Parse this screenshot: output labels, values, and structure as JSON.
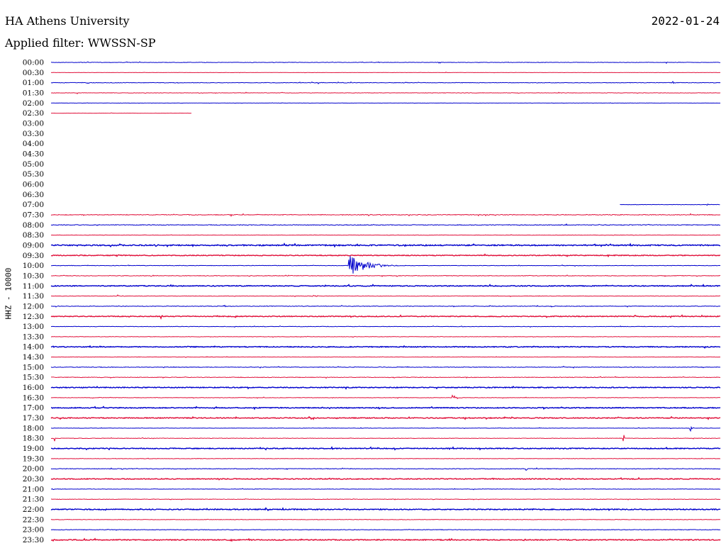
{
  "header": {
    "title": "HA Athens University",
    "filter": "Applied filter: WWSSN-SP",
    "date": "2022-01-24"
  },
  "channel_label": "HHZ - 10000",
  "colors": {
    "even_trace": "#0000cc",
    "odd_trace": "#e0103a",
    "background": "#ffffff"
  },
  "chart_data": {
    "type": "line",
    "title": "HA Athens University",
    "subtitle": "Applied filter: WWSSN-SP",
    "ylabel": "HHZ - 10000",
    "time_labels": [
      "00:00",
      "00:30",
      "01:00",
      "01:30",
      "02:00",
      "02:30",
      "03:00",
      "03:30",
      "04:00",
      "04:30",
      "05:00",
      "05:30",
      "06:00",
      "06:30",
      "07:00",
      "07:30",
      "08:00",
      "08:30",
      "09:00",
      "09:30",
      "10:00",
      "10:30",
      "11:00",
      "11:30",
      "12:00",
      "12:30",
      "13:00",
      "13:30",
      "14:00",
      "14:30",
      "15:00",
      "15:30",
      "16:00",
      "16:30",
      "17:00",
      "17:30",
      "18:00",
      "18:30",
      "19:00",
      "19:30",
      "20:00",
      "20:30",
      "21:00",
      "21:30",
      "22:00",
      "22:30",
      "23:00",
      "23:30"
    ],
    "minutes_per_line": 30,
    "traces": [
      {
        "t": "00:00",
        "start": 0,
        "end": 1,
        "noise": 0.6,
        "events": [
          [
            0.3,
            0.8,
            2
          ],
          [
            0.49,
            0.8,
            2
          ],
          [
            0.58,
            0.8,
            2
          ],
          [
            0.92,
            1.5,
            4
          ]
        ]
      },
      {
        "t": "00:30",
        "start": 0,
        "end": 1,
        "noise": 0.3,
        "events": [
          [
            0.59,
            0.8,
            2
          ]
        ]
      },
      {
        "t": "01:00",
        "start": 0,
        "end": 1,
        "noise": 0.7,
        "events": [
          [
            0.4,
            1.5,
            10
          ],
          [
            0.53,
            0.8,
            2
          ],
          [
            0.93,
            1.2,
            6
          ]
        ]
      },
      {
        "t": "01:30",
        "start": 0,
        "end": 1,
        "noise": 0.6,
        "events": [
          [
            0.04,
            1,
            8
          ],
          [
            0.14,
            0.8,
            2
          ]
        ]
      },
      {
        "t": "02:00",
        "start": 0,
        "end": 1,
        "noise": 0.3,
        "events": []
      },
      {
        "t": "02:30",
        "start": 0,
        "end": 0.21,
        "noise": 0.3,
        "events": [
          [
            0.09,
            0.8,
            2
          ]
        ]
      },
      {
        "t": "07:00",
        "start": 0.85,
        "end": 1,
        "noise": 0.5,
        "events": [
          [
            0.98,
            1,
            2
          ]
        ]
      },
      {
        "t": "07:30",
        "start": 0,
        "end": 1,
        "noise": 1.0,
        "events": [
          [
            0.27,
            1,
            3
          ],
          [
            0.38,
            1.6,
            3
          ]
        ]
      },
      {
        "t": "08:00",
        "start": 0,
        "end": 1,
        "noise": 1.0,
        "events": []
      },
      {
        "t": "08:30",
        "start": 0,
        "end": 1,
        "noise": 0.5,
        "events": []
      },
      {
        "t": "09:00",
        "start": 0,
        "end": 1,
        "noise": 1.6,
        "events": []
      },
      {
        "t": "09:30",
        "start": 0,
        "end": 1,
        "noise": 1.1,
        "events": []
      },
      {
        "t": "10:00",
        "start": 0,
        "end": 1,
        "noise": 0.6,
        "events": [
          [
            0.445,
            16,
            70
          ],
          [
            0.7,
            1,
            2
          ]
        ]
      },
      {
        "t": "10:30",
        "start": 0,
        "end": 1,
        "noise": 0.8,
        "events": [
          [
            0.15,
            1.5,
            22
          ],
          [
            0.28,
            0.8,
            2
          ]
        ]
      },
      {
        "t": "11:00",
        "start": 0,
        "end": 1,
        "noise": 1.2,
        "events": []
      },
      {
        "t": "11:30",
        "start": 0,
        "end": 1,
        "noise": 0.6,
        "events": [
          [
            0.1,
            1.8,
            14
          ],
          [
            0.39,
            2,
            20
          ]
        ]
      },
      {
        "t": "12:00",
        "start": 0,
        "end": 1,
        "noise": 0.8,
        "events": [
          [
            0.26,
            1.4,
            3
          ],
          [
            0.58,
            1.4,
            3
          ],
          [
            0.72,
            1,
            2
          ]
        ]
      },
      {
        "t": "12:30",
        "start": 0,
        "end": 1,
        "noise": 1.1,
        "events": [
          [
            0.165,
            4,
            3
          ]
        ]
      },
      {
        "t": "13:00",
        "start": 0,
        "end": 1,
        "noise": 0.6,
        "events": []
      },
      {
        "t": "13:30",
        "start": 0,
        "end": 1,
        "noise": 0.6,
        "events": []
      },
      {
        "t": "14:00",
        "start": 0,
        "end": 1,
        "noise": 1.2,
        "events": []
      },
      {
        "t": "14:30",
        "start": 0,
        "end": 1,
        "noise": 0.5,
        "events": []
      },
      {
        "t": "15:00",
        "start": 0,
        "end": 1,
        "noise": 0.8,
        "events": []
      },
      {
        "t": "15:30",
        "start": 0,
        "end": 1,
        "noise": 0.8,
        "events": []
      },
      {
        "t": "16:00",
        "start": 0,
        "end": 1,
        "noise": 1.2,
        "events": []
      },
      {
        "t": "16:30",
        "start": 0,
        "end": 1,
        "noise": 0.6,
        "events": [
          [
            0.6,
            3,
            24
          ]
        ]
      },
      {
        "t": "17:00",
        "start": 0,
        "end": 1,
        "noise": 1.2,
        "events": []
      },
      {
        "t": "17:30",
        "start": 0,
        "end": 1,
        "noise": 1.2,
        "events": []
      },
      {
        "t": "18:00",
        "start": 0,
        "end": 1,
        "noise": 0.5,
        "events": [
          [
            0.955,
            4.5,
            8
          ]
        ]
      },
      {
        "t": "18:30",
        "start": 0,
        "end": 1,
        "noise": 0.6,
        "events": [
          [
            0.005,
            7,
            1
          ],
          [
            0.855,
            8,
            1
          ]
        ]
      },
      {
        "t": "19:00",
        "start": 0,
        "end": 1,
        "noise": 1.2,
        "events": []
      },
      {
        "t": "19:30",
        "start": 0,
        "end": 1,
        "noise": 0.6,
        "events": []
      },
      {
        "t": "20:00",
        "start": 0,
        "end": 1,
        "noise": 0.8,
        "events": [
          [
            0.71,
            2,
            1
          ]
        ]
      },
      {
        "t": "20:30",
        "start": 0,
        "end": 1,
        "noise": 1.2,
        "events": []
      },
      {
        "t": "21:00",
        "start": 0,
        "end": 1,
        "noise": 0.6,
        "events": []
      },
      {
        "t": "21:30",
        "start": 0,
        "end": 1,
        "noise": 0.6,
        "events": []
      },
      {
        "t": "22:00",
        "start": 0,
        "end": 1,
        "noise": 1.3,
        "events": []
      },
      {
        "t": "22:30",
        "start": 0,
        "end": 1,
        "noise": 0.6,
        "events": []
      },
      {
        "t": "23:00",
        "start": 0,
        "end": 1,
        "noise": 0.7,
        "events": []
      },
      {
        "t": "23:30",
        "start": 0,
        "end": 1,
        "noise": 1.3,
        "events": []
      }
    ]
  }
}
